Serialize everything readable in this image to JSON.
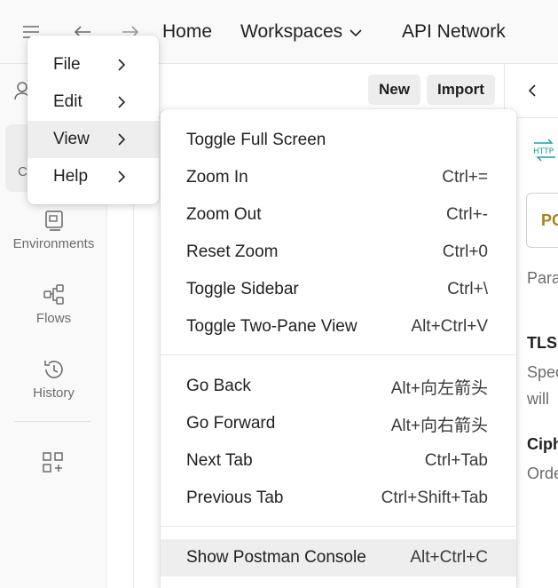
{
  "topbar": {
    "menu_icon": "hamburger-icon",
    "back_icon": "arrow-left-icon",
    "forward_icon": "arrow-right-icon",
    "home": "Home",
    "workspaces": "Workspaces",
    "api_network": "API Network"
  },
  "sidebar": {
    "items": [
      {
        "label": "Environments",
        "icon": "environments-icon"
      },
      {
        "label": "Flows",
        "icon": "flows-icon"
      },
      {
        "label": "History",
        "icon": "history-icon"
      }
    ],
    "add_icon": "add-apps-icon",
    "partial_label": "C"
  },
  "toolbar": {
    "new_label": "New",
    "import_label": "Import"
  },
  "right_panel": {
    "method": "PO",
    "lines": [
      "Para",
      "TLS",
      "Spec",
      "will",
      "Ciph",
      "Orde"
    ]
  },
  "main_menu": {
    "items": [
      {
        "label": "File"
      },
      {
        "label": "Edit"
      },
      {
        "label": "View"
      },
      {
        "label": "Help"
      }
    ]
  },
  "view_menu": {
    "group1": [
      {
        "label": "Toggle Full Screen",
        "shortcut": ""
      },
      {
        "label": "Zoom In",
        "shortcut": "Ctrl+="
      },
      {
        "label": "Zoom Out",
        "shortcut": "Ctrl+-"
      },
      {
        "label": "Reset Zoom",
        "shortcut": "Ctrl+0"
      },
      {
        "label": "Toggle Sidebar",
        "shortcut": "Ctrl+\\"
      },
      {
        "label": "Toggle Two-Pane View",
        "shortcut": "Alt+Ctrl+V"
      }
    ],
    "group2": [
      {
        "label": "Go Back",
        "shortcut": "Alt+向左箭头"
      },
      {
        "label": "Go Forward",
        "shortcut": "Alt+向右箭头"
      },
      {
        "label": "Next Tab",
        "shortcut": "Ctrl+Tab"
      },
      {
        "label": "Previous Tab",
        "shortcut": "Ctrl+Shift+Tab"
      }
    ],
    "group3": [
      {
        "label": "Show Postman Console",
        "shortcut": "Alt+Ctrl+C"
      }
    ]
  },
  "colors": {
    "accent_method": "#a8841c",
    "highlight": "#eeeeee"
  }
}
